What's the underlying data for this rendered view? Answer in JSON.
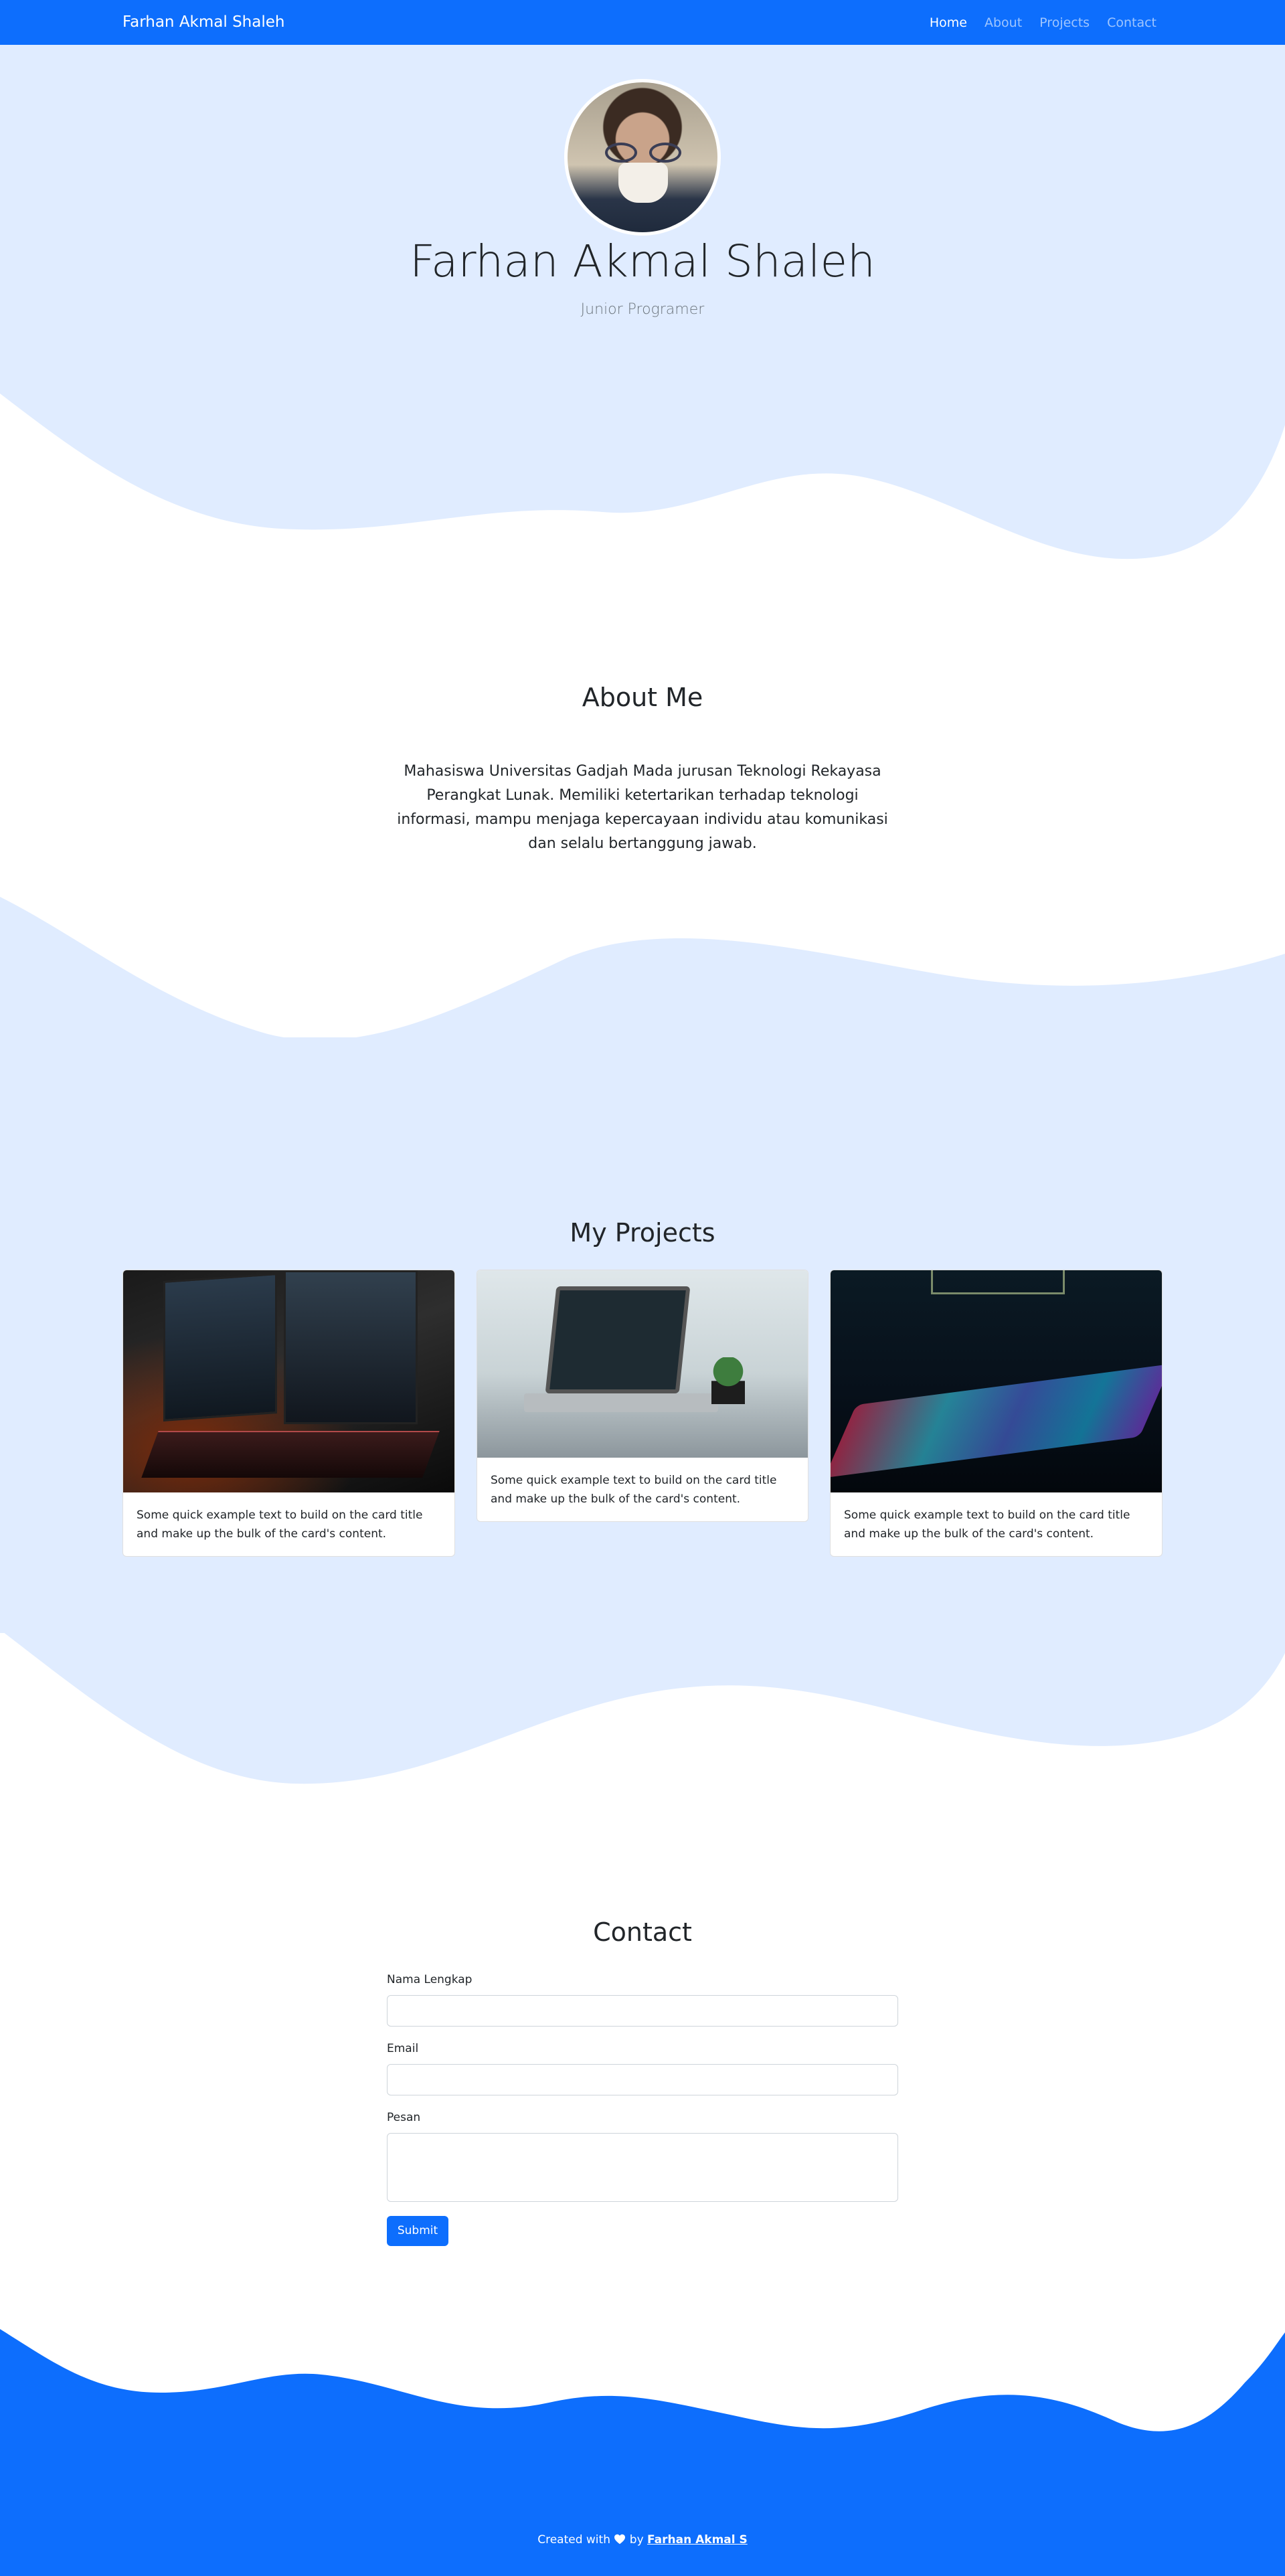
{
  "navbar": {
    "brand": "Farhan Akmal Shaleh",
    "links": [
      "Home",
      "About",
      "Projects",
      "Contact"
    ],
    "active": "Home",
    "color": "#0d6efd"
  },
  "hero": {
    "name": "Farhan Akmal Shaleh",
    "role": "Junior Programer",
    "background": "#e0ecff"
  },
  "about": {
    "title": "About Me",
    "text": "Mahasiswa Universitas Gadjah Mada jurusan Teknologi Rekayasa Perangkat Lunak. Memiliki ketertarikan terhadap teknologi informasi, mampu menjaga kepercayaan individu atau komunikasi dan selalu bertanggung jawab."
  },
  "projects": {
    "title": "My Projects",
    "cards": [
      {
        "text": "Some quick example text to build on the card title and make up the bulk of the card's content."
      },
      {
        "text": "Some quick example text to build on the card title and make up the bulk of the card's content."
      },
      {
        "text": "Some quick example text to build on the card title and make up the bulk of the card's content."
      }
    ]
  },
  "contact": {
    "title": "Contact",
    "fields": {
      "name_label": "Nama Lengkap",
      "name_value": "",
      "email_label": "Email",
      "email_value": "",
      "message_label": "Pesan",
      "message_value": ""
    },
    "submit_label": "Submit"
  },
  "footer": {
    "prefix": "Created with",
    "icon": "heart-icon",
    "by": "by",
    "author": "Farhan Akmal S"
  }
}
